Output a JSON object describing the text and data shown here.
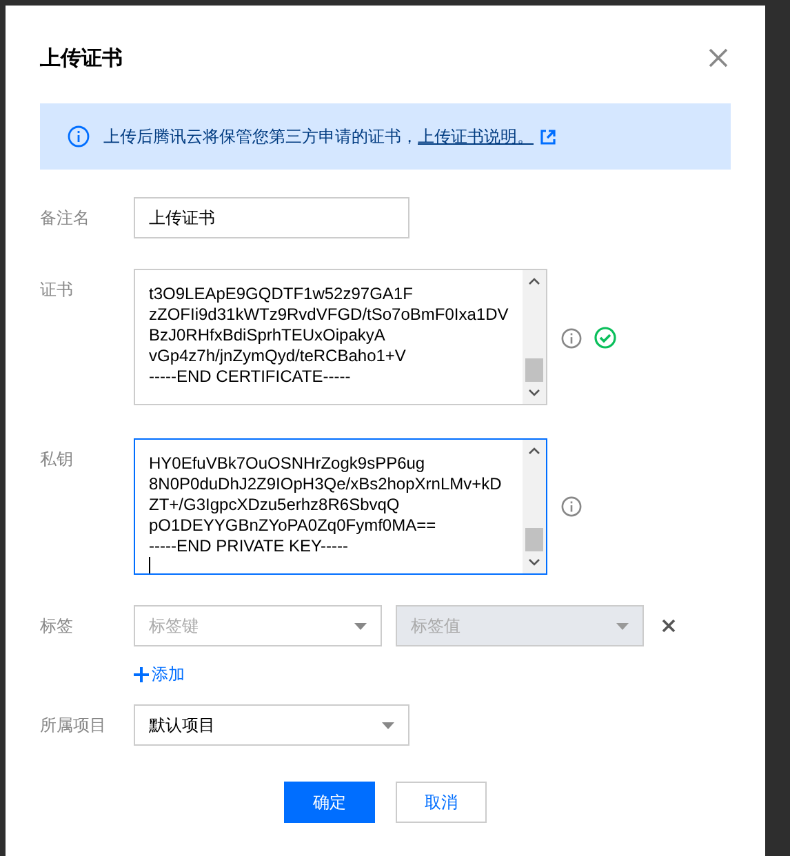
{
  "dialog": {
    "title": "上传证书"
  },
  "notice": {
    "text": "上传后腾讯云将保管您第三方申请的证书，",
    "link": "上传证书说明。"
  },
  "form": {
    "remark": {
      "label": "备注名",
      "value": "上传证书"
    },
    "certificate": {
      "label": "证书",
      "focused": false,
      "valid": true,
      "lines": [
        "t3O9LEApE9GQDTF1w52z97GA1F",
        "zZOFIi9d31kWTz9RvdVFGD/tSo7oBmF0Ixa1DV",
        "BzJ0RHfxBdiSprhTEUxOipakyA",
        "vGp4z7h/jnZymQyd/teRCBaho1+V",
        "-----END CERTIFICATE-----"
      ]
    },
    "private_key": {
      "label": "私钥",
      "focused": true,
      "lines": [
        "HY0EfuVBk7OuOSNHrZogk9sPP6ug",
        "8N0P0duDhJ2Z9IOpH3Qe/xBs2hopXrnLMv+kD",
        "ZT+/G3IgpcXDzu5erhz8R6SbvqQ",
        "pO1DEYYGBnZYoPA0Zq0Fymf0MA==",
        "-----END PRIVATE KEY-----"
      ]
    },
    "tags": {
      "label": "标签",
      "key_placeholder": "标签键",
      "value_placeholder": "标签值",
      "value_disabled": true,
      "add": "添加"
    },
    "project": {
      "label": "所属项目",
      "value": "默认项目"
    }
  },
  "buttons": [
    {
      "label": "确定",
      "kind": "primary"
    },
    {
      "label": "取消",
      "kind": "secondary"
    }
  ]
}
